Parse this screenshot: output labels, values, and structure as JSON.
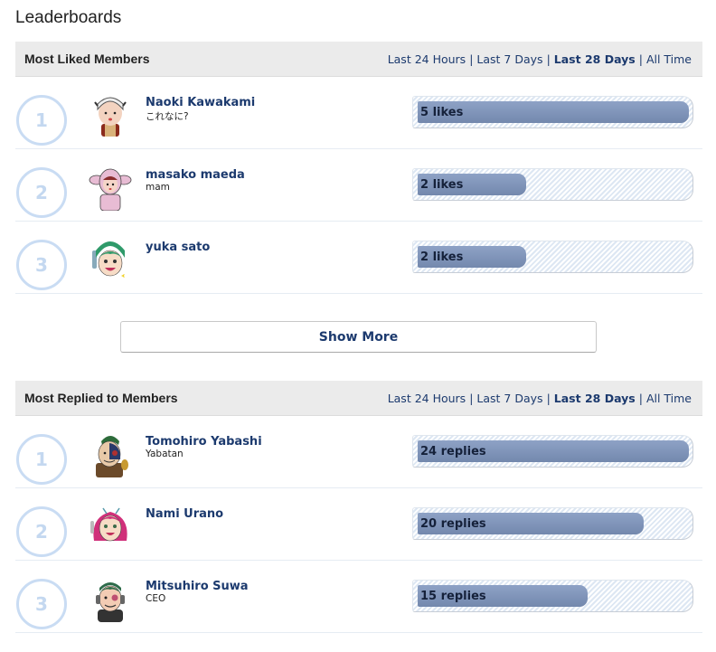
{
  "page": {
    "title": "Leaderboards"
  },
  "filters": [
    "Last 24 Hours",
    "Last 7 Days",
    "Last 28 Days",
    "All Time"
  ],
  "active_filter": "Last 28 Days",
  "sections": [
    {
      "title": "Most Liked Members",
      "max_value": 5,
      "rows": [
        {
          "rank": "1",
          "name": "Naoki Kawakami",
          "subtitle": "これなに?",
          "value": 5,
          "label": "5 likes",
          "avatar": "avatar-white-hood"
        },
        {
          "rank": "2",
          "name": "masako maeda",
          "subtitle": "mam",
          "value": 2,
          "label": "2 likes",
          "avatar": "avatar-pink-bunny"
        },
        {
          "rank": "3",
          "name": "yuka sato",
          "subtitle": "",
          "value": 2,
          "label": "2 likes",
          "avatar": "avatar-green-hair"
        }
      ],
      "show_more_label": "Show More"
    },
    {
      "title": "Most Replied to Members",
      "max_value": 24,
      "rows": [
        {
          "rank": "1",
          "name": "Tomohiro Yabashi",
          "subtitle": "Yabatan",
          "value": 24,
          "label": "24 replies",
          "avatar": "avatar-eyepatch"
        },
        {
          "rank": "2",
          "name": "Nami Urano",
          "subtitle": "",
          "value": 20,
          "label": "20 replies",
          "avatar": "avatar-pink-hair"
        },
        {
          "rank": "3",
          "name": "Mitsuhiro Suwa",
          "subtitle": "CEO",
          "value": 15,
          "label": "15 replies",
          "avatar": "avatar-headphones"
        }
      ]
    }
  ],
  "colors": {
    "link": "#1c3a6e",
    "rank_circle": "#c9dcf3",
    "bar_fill_top": "#8ea2c6",
    "bar_fill_bottom": "#7388ad",
    "header_bg": "#ebebeb"
  }
}
